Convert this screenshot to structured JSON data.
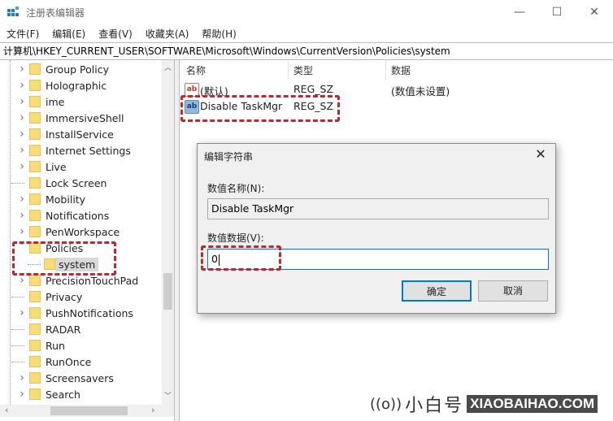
{
  "window": {
    "title": "注册表编辑器",
    "controls": {
      "minimize": "—",
      "maximize": "☐",
      "close": "✕"
    }
  },
  "menu": [
    "文件(F)",
    "编辑(E)",
    "查看(V)",
    "收藏夹(A)",
    "帮助(H)"
  ],
  "address": "计算机\\HKEY_CURRENT_USER\\SOFTWARE\\Microsoft\\Windows\\CurrentVersion\\Policies\\system",
  "tree": {
    "items": [
      {
        "label": "Group Policy",
        "expander": "collapsed"
      },
      {
        "label": "Holographic",
        "expander": "collapsed"
      },
      {
        "label": "ime",
        "expander": "collapsed"
      },
      {
        "label": "ImmersiveShell",
        "expander": "collapsed"
      },
      {
        "label": "InstallService",
        "expander": "collapsed"
      },
      {
        "label": "Internet Settings",
        "expander": "collapsed"
      },
      {
        "label": "Live",
        "expander": "collapsed"
      },
      {
        "label": "Lock Screen",
        "expander": "none"
      },
      {
        "label": "Mobility",
        "expander": "collapsed"
      },
      {
        "label": "Notifications",
        "expander": "collapsed"
      },
      {
        "label": "PenWorkspace",
        "expander": "collapsed"
      },
      {
        "label": "Policies",
        "expander": "expanded"
      },
      {
        "label": "system",
        "expander": "none",
        "child": true,
        "selected": true
      },
      {
        "label": "PrecisionTouchPad",
        "expander": "collapsed"
      },
      {
        "label": "Privacy",
        "expander": "none"
      },
      {
        "label": "PushNotifications",
        "expander": "collapsed"
      },
      {
        "label": "RADAR",
        "expander": "none"
      },
      {
        "label": "Run",
        "expander": "none"
      },
      {
        "label": "RunOnce",
        "expander": "none"
      },
      {
        "label": "Screensavers",
        "expander": "collapsed"
      },
      {
        "label": "Search",
        "expander": "collapsed"
      }
    ]
  },
  "list": {
    "columns": [
      "名称",
      "类型",
      "数据"
    ],
    "rows": [
      {
        "icon": "string-value-icon",
        "name": "(默认)",
        "type": "REG_SZ",
        "data": "(数值未设置)"
      },
      {
        "icon": "string-value-icon",
        "name": "Disable TaskMgr",
        "type": "REG_SZ",
        "data": ""
      }
    ]
  },
  "dialog": {
    "title": "编辑字符串",
    "name_label": "数值名称(N):",
    "name_value": "Disable TaskMgr",
    "data_label": "数值数据(V):",
    "data_value": "0",
    "ok": "确定",
    "cancel": "取消",
    "close": "✕"
  },
  "watermark": {
    "brand_cn": "小白号",
    "brand_url": "XIAOBAIHAO.COM"
  },
  "colors": {
    "highlight_red": "#c0282d",
    "folder": "#f7dc7a",
    "dialog_bg": "#f0f0f0",
    "focus_blue": "#0078d7"
  }
}
